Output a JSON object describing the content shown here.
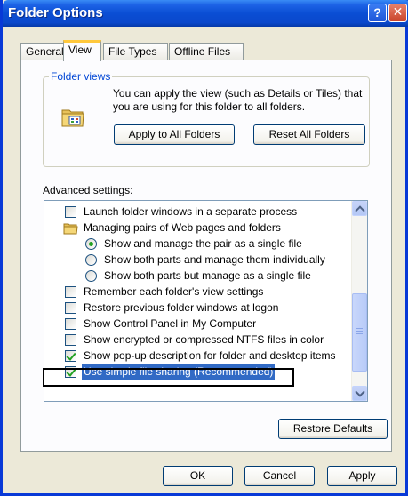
{
  "window": {
    "title": "Folder Options",
    "help_glyph": "?",
    "close_glyph": "✕"
  },
  "tabs": [
    {
      "label": "General"
    },
    {
      "label": "View"
    },
    {
      "label": "File Types"
    },
    {
      "label": "Offline Files"
    }
  ],
  "active_tab": "View",
  "folder_views": {
    "label": "Folder views",
    "description": "You can apply the view (such as Details or Tiles) that you are using for this folder to all folders.",
    "apply_all_label": "Apply to All Folders",
    "reset_all_label": "Reset All Folders"
  },
  "advanced": {
    "label": "Advanced settings:",
    "items": [
      {
        "type": "checkbox",
        "checked": false,
        "label": "Launch folder windows in a separate process"
      },
      {
        "type": "folder",
        "label": "Managing pairs of Web pages and folders"
      },
      {
        "type": "radio",
        "checked": true,
        "label": "Show and manage the pair as a single file"
      },
      {
        "type": "radio",
        "checked": false,
        "label": "Show both parts and manage them individually"
      },
      {
        "type": "radio",
        "checked": false,
        "label": "Show both parts but manage as a single file"
      },
      {
        "type": "checkbox",
        "checked": false,
        "label": "Remember each folder's view settings"
      },
      {
        "type": "checkbox",
        "checked": false,
        "label": "Restore previous folder windows at logon"
      },
      {
        "type": "checkbox",
        "checked": false,
        "label": "Show Control Panel in My Computer"
      },
      {
        "type": "checkbox",
        "checked": false,
        "label": "Show encrypted or compressed NTFS files in color"
      },
      {
        "type": "checkbox",
        "checked": true,
        "label": "Show pop-up description for folder and desktop items"
      },
      {
        "type": "checkbox",
        "checked": true,
        "label": "Use simple file sharing (Recommended)",
        "selected": true
      }
    ],
    "scroll_position": 0.95
  },
  "buttons": {
    "restore_defaults": "Restore Defaults",
    "ok": "OK",
    "cancel": "Cancel",
    "apply": "Apply"
  },
  "colors": {
    "titlebar": "#0a4ed4",
    "selection": "#316ac5",
    "group_label": "#0046d5",
    "active_tab_accent": "#ffc83c"
  }
}
